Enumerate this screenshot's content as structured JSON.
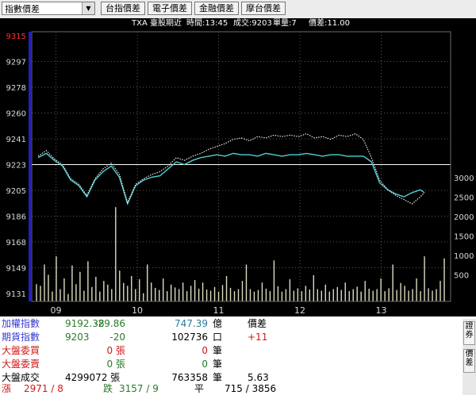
{
  "toolbar": {
    "dropdown_value": "指數價差",
    "buttons": [
      "台指價差",
      "電子價差",
      "金融價差",
      "摩台價差"
    ]
  },
  "chart_header": {
    "code": "TXA",
    "title": "臺股期近",
    "time_label": "時間:13:45",
    "trade_label": "成交:9203",
    "volume_label": "單量:7",
    "spread_label": "價差:11.00"
  },
  "chart_data": {
    "type": "line",
    "title": "",
    "y_axis_left": {
      "ticks": [
        "9315",
        "9297",
        "9278",
        "9260",
        "9241",
        "9223",
        "9205",
        "9186",
        "9168",
        "9149",
        "9131"
      ],
      "range": [
        9131,
        9315
      ]
    },
    "y_axis_right": {
      "ticks": [
        "3000",
        "2500",
        "2000",
        "1500",
        "1000",
        "500"
      ]
    },
    "x_ticks": [
      "09",
      "10",
      "11",
      "12",
      "13"
    ],
    "reference_line": 9223,
    "grid": true,
    "series": [
      {
        "key": "index",
        "color": "#4ecfd2",
        "style": "solid",
        "x": [
          0,
          0.1,
          0.2,
          0.3,
          0.4,
          0.5,
          0.6,
          0.7,
          0.8,
          0.9,
          1.0,
          1.1,
          1.2,
          1.3,
          1.4,
          1.5,
          1.6,
          1.7,
          1.8,
          1.9,
          2.0,
          2.1,
          2.2,
          2.3,
          2.4,
          2.5,
          2.6,
          2.7,
          2.8,
          2.9,
          3.0,
          3.1,
          3.2,
          3.3,
          3.4,
          3.5,
          3.6,
          3.7,
          3.8,
          3.9,
          4.0,
          4.1,
          4.2,
          4.3,
          4.4,
          4.5,
          4.6,
          4.7,
          4.75
        ],
        "y": [
          9228,
          9231,
          9226,
          9222,
          9212,
          9208,
          9200,
          9212,
          9218,
          9222,
          9214,
          9195,
          9208,
          9212,
          9214,
          9215,
          9220,
          9225,
          9223,
          9226,
          9228,
          9229,
          9230,
          9229,
          9231,
          9230,
          9230,
          9229,
          9231,
          9230,
          9229,
          9230,
          9230,
          9231,
          9230,
          9229,
          9230,
          9230,
          9229,
          9229,
          9229,
          9225,
          9210,
          9205,
          9202,
          9200,
          9203,
          9205,
          9203
        ]
      },
      {
        "key": "futures",
        "color": "#e8e8e8",
        "style": "dotted",
        "x": [
          0,
          0.1,
          0.2,
          0.3,
          0.4,
          0.5,
          0.6,
          0.7,
          0.8,
          0.9,
          1.0,
          1.1,
          1.2,
          1.3,
          1.4,
          1.5,
          1.6,
          1.7,
          1.8,
          1.9,
          2.0,
          2.1,
          2.2,
          2.3,
          2.4,
          2.5,
          2.6,
          2.7,
          2.8,
          2.9,
          3.0,
          3.1,
          3.2,
          3.3,
          3.4,
          3.5,
          3.6,
          3.7,
          3.8,
          3.9,
          4.0,
          4.1,
          4.2,
          4.3,
          4.4,
          4.5,
          4.6,
          4.7,
          4.75
        ],
        "y": [
          9229,
          9233,
          9227,
          9223,
          9213,
          9209,
          9201,
          9213,
          9220,
          9224,
          9216,
          9196,
          9209,
          9213,
          9216,
          9218,
          9222,
          9228,
          9226,
          9229,
          9231,
          9234,
          9236,
          9238,
          9241,
          9242,
          9240,
          9243,
          9242,
          9244,
          9243,
          9244,
          9243,
          9245,
          9242,
          9243,
          9241,
          9244,
          9243,
          9245,
          9241,
          9228,
          9212,
          9205,
          9201,
          9198,
          9195,
          9200,
          9203
        ]
      },
      {
        "key": "volume",
        "color": "#dcdcc0",
        "style": "bars",
        "axis": "right",
        "values": [
          420,
          380,
          900,
          650,
          240,
          1100,
          300,
          560,
          180,
          880,
          420,
          720,
          260,
          980,
          350,
          600,
          240,
          500,
          410,
          300,
          2300,
          750,
          450,
          380,
          620,
          300,
          540,
          200,
          900,
          460,
          330,
          280,
          560,
          250,
          410,
          340,
          300,
          460,
          250,
          380,
          520,
          310,
          460,
          290,
          260,
          350,
          240,
          400,
          620,
          330,
          250,
          300,
          500,
          900,
          300,
          240,
          280,
          460,
          310,
          250,
          1000,
          370,
          240,
          300,
          540,
          260,
          320,
          250,
          380,
          290,
          640,
          300,
          260,
          410,
          240,
          300,
          350,
          280,
          460,
          250,
          300,
          360,
          240,
          500,
          310,
          260,
          300,
          560,
          250,
          320,
          900,
          280,
          450,
          380,
          260,
          300,
          560,
          250,
          1100,
          320,
          260,
          300,
          500,
          1050
        ]
      }
    ]
  },
  "summary_rows": [
    {
      "label": "加權指數",
      "label_color": "#3a3ad0",
      "value": "9192.38",
      "value_color": "#2a7a2a",
      "change": "-29.86",
      "change_color": "#2a7a2a",
      "amount": "747.39",
      "amount_color": "#2a7a9a",
      "unit": "億",
      "extra": "價差",
      "extra_color": "#000000"
    },
    {
      "label": "期貨指數",
      "label_color": "#3a3ad0",
      "value": "9203",
      "value_color": "#2a7a2a",
      "change": "-20",
      "change_color": "#2a7a2a",
      "amount": "102736",
      "amount_color": "#000000",
      "unit": "口",
      "extra": "+11",
      "extra_color": "#d01818"
    },
    {
      "label": "大盤委買",
      "label_color": "#d01818",
      "value": "",
      "value_color": "#000000",
      "change": "0 張",
      "change_color": "#d01818",
      "amount": "0",
      "amount_color": "#d01818",
      "unit": "筆",
      "extra": "",
      "extra_color": "#000000"
    },
    {
      "label": "大盤委賣",
      "label_color": "#d01818",
      "value": "",
      "value_color": "#000000",
      "change": "0 張",
      "change_color": "#2a7a2a",
      "amount": "0",
      "amount_color": "#2a7a2a",
      "unit": "筆",
      "extra": "",
      "extra_color": "#000000"
    },
    {
      "label": "大盤成交",
      "label_color": "#000000",
      "value": "4299072 張",
      "value_color": "#000000",
      "change": "",
      "change_color": "#000000",
      "amount": "763358",
      "amount_color": "#000000",
      "unit": "筆",
      "extra": "5.63",
      "extra_color": "#000000"
    }
  ],
  "breadth": {
    "up_label": "漲",
    "up_value": "2971 / 8",
    "up_color": "#d01818",
    "down_label": "跌",
    "down_value": "3157 / 9",
    "down_color": "#2a7a2a",
    "flat_label": "平",
    "flat_value": "715 / 3856",
    "flat_color": "#000000"
  },
  "side_tabs": [
    "證券",
    "價差"
  ]
}
